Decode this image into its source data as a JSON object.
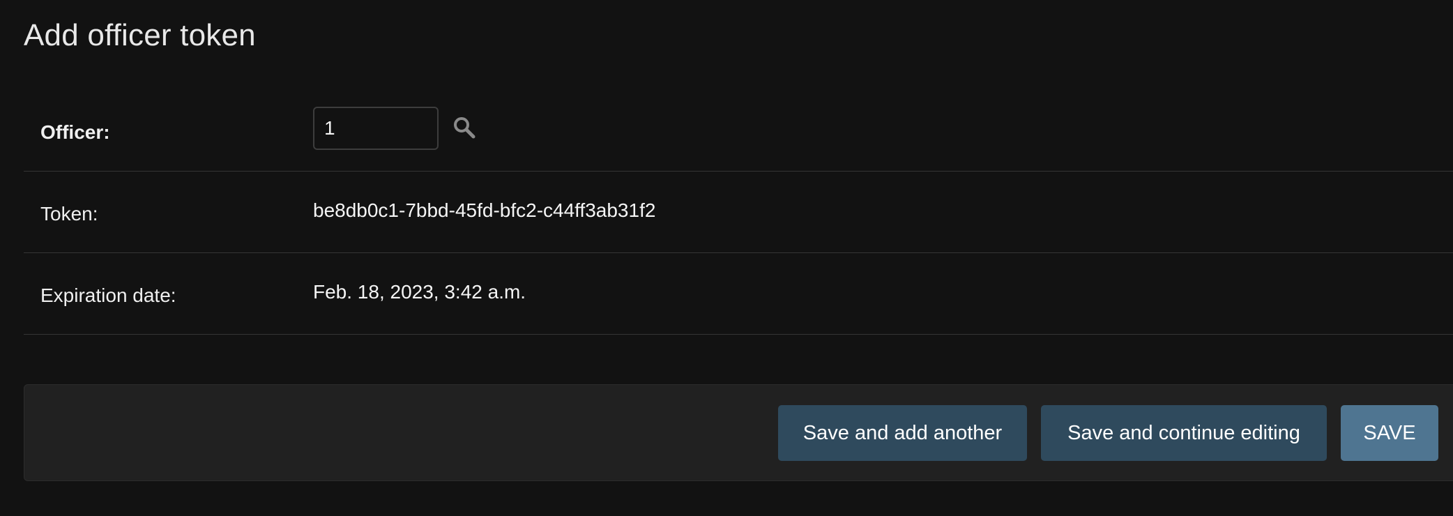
{
  "page": {
    "title": "Add officer token"
  },
  "form": {
    "officer": {
      "label": "Officer:",
      "value": "1"
    },
    "token": {
      "label": "Token:",
      "value": "be8db0c1-7bbd-45fd-bfc2-c44ff3ab31f2"
    },
    "expiration_date": {
      "label": "Expiration date:",
      "value": "Feb. 18, 2023, 3:42 a.m."
    },
    "lookup_icon": "search-icon"
  },
  "submit_row": {
    "save_and_add_another": "Save and add another",
    "save_and_continue": "Save and continue editing",
    "save": "SAVE"
  },
  "colors": {
    "background": "#121212",
    "submit_row_bg": "#212121",
    "secondary_button": "#2f4a5d",
    "primary_button": "#4f7591",
    "row_border": "#353535"
  }
}
